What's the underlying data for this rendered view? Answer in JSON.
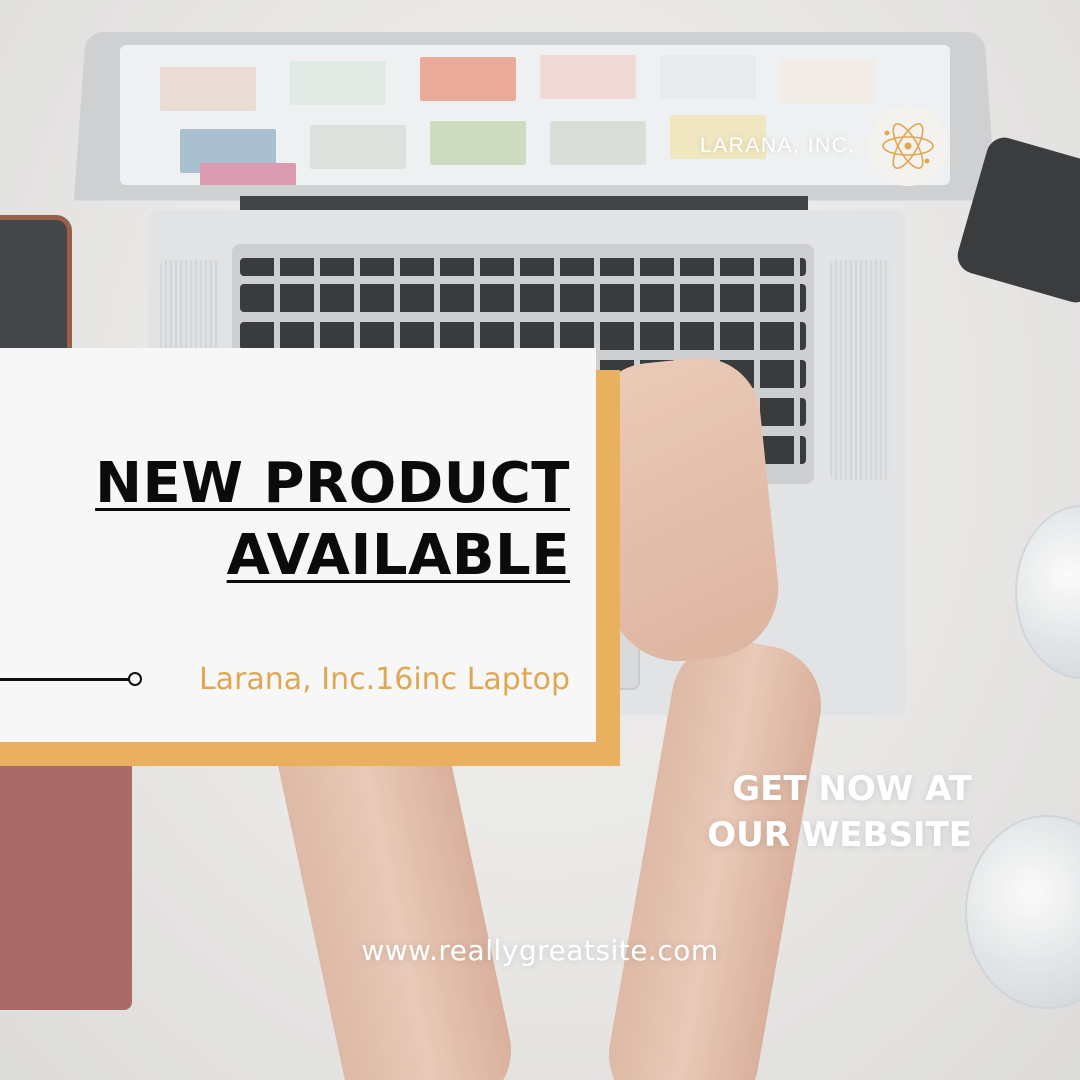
{
  "brand": {
    "name": "LARANA, INC.",
    "logo_icon": "atom-icon",
    "logo_color": "#e0a752"
  },
  "headline": {
    "line1": "NEW PRODUCT",
    "line2": "AVAILABLE"
  },
  "product": {
    "subtitle": "Larana, Inc.16inc Laptop"
  },
  "cta": {
    "line1": "GET NOW AT",
    "line2": "OUR WEBSITE"
  },
  "website": "www.reallygreatsite.com",
  "colors": {
    "accent": "#e8b05f",
    "card": "#f7f7f7",
    "headline_text": "#0b0b0b",
    "subtitle_text": "#e0a752",
    "cta_text": "#ffffff"
  }
}
